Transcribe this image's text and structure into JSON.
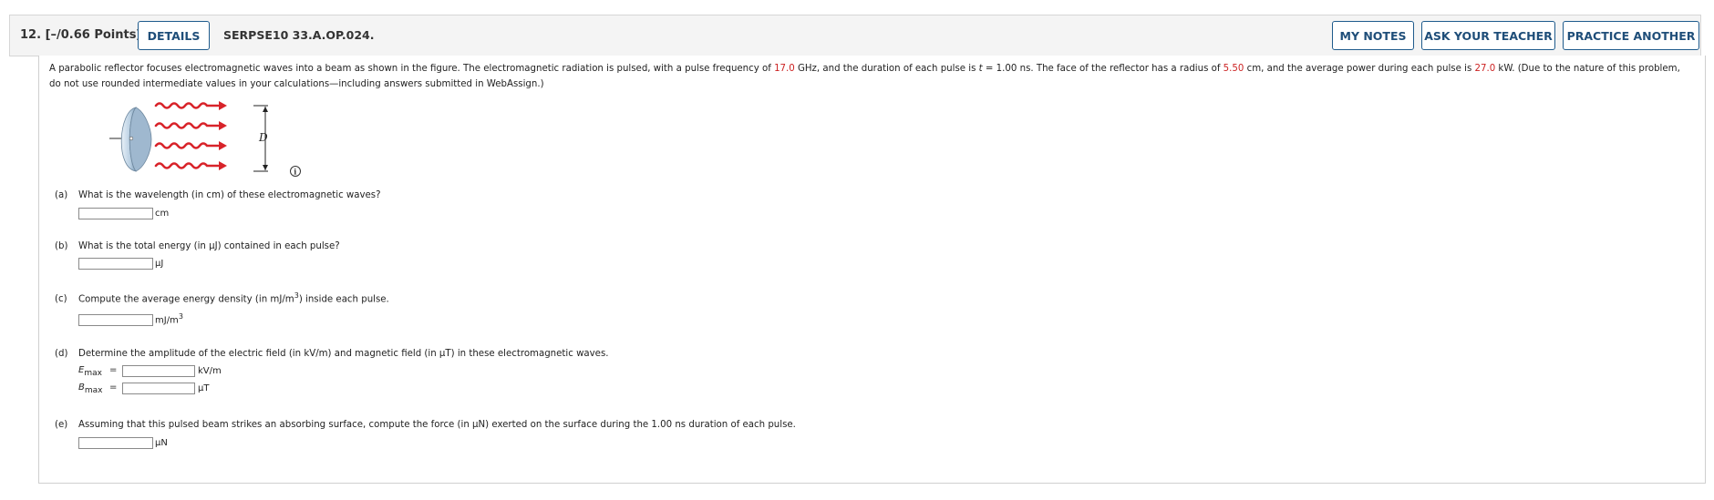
{
  "header": {
    "question_number": "12.",
    "points": "[–/0.66 Points]",
    "details_label": "DETAILS",
    "question_code": "SERPSE10 33.A.OP.024.",
    "my_notes_label": "MY NOTES",
    "ask_teacher_label": "ASK YOUR TEACHER",
    "practice_another_label": "PRACTICE ANOTHER"
  },
  "intro": {
    "t1": "A parabolic reflector focuses electromagnetic waves into a beam as shown in the figure. The electromagnetic radiation is pulsed, with a pulse frequency of ",
    "freq": "17.0",
    "t2": " GHz, and the duration of each pulse is ",
    "tvar": "t",
    "t3": " = 1.00 ns. The face of the reflector has a radius of ",
    "radius": "5.50",
    "t4": " cm, and the average power during each pulse is ",
    "power": "27.0",
    "t5": " kW. (Due to the nature of this problem, do not use rounded intermediate values in your calculations—including answers submitted in WebAssign.)"
  },
  "figure": {
    "d_label": "D",
    "info_glyph": "i"
  },
  "parts": {
    "a": {
      "letter": "(a)",
      "text": "What is the wavelength (in cm) of these electromagnetic waves?",
      "unit": "cm"
    },
    "b": {
      "letter": "(b)",
      "text": "What is the total energy (in µJ) contained in each pulse?",
      "unit": "µJ"
    },
    "c": {
      "letter": "(c)",
      "text_pre": "Compute the average energy density (in mJ/m",
      "sup": "3",
      "text_post": ") inside each pulse.",
      "unit_base": "mJ/m",
      "unit_sup": "3"
    },
    "d": {
      "letter": "(d)",
      "text": "Determine the amplitude of the electric field (in kV/m) and magnetic field (in µT) in these electromagnetic waves.",
      "e_sym": "E",
      "e_sub": "max",
      "b_sym": "B",
      "b_sub": "max",
      "eq": "=",
      "e_unit": "kV/m",
      "b_unit": "µT"
    },
    "e": {
      "letter": "(e)",
      "text": "Assuming that this pulsed beam strikes an absorbing surface, compute the force (in µN) exerted on the surface during the 1.00 ns duration of each pulse.",
      "unit": "µN"
    }
  },
  "colors": {
    "accent": "#1f4e79",
    "highlight_red": "#cc2222",
    "wave_red": "#d8232a"
  }
}
